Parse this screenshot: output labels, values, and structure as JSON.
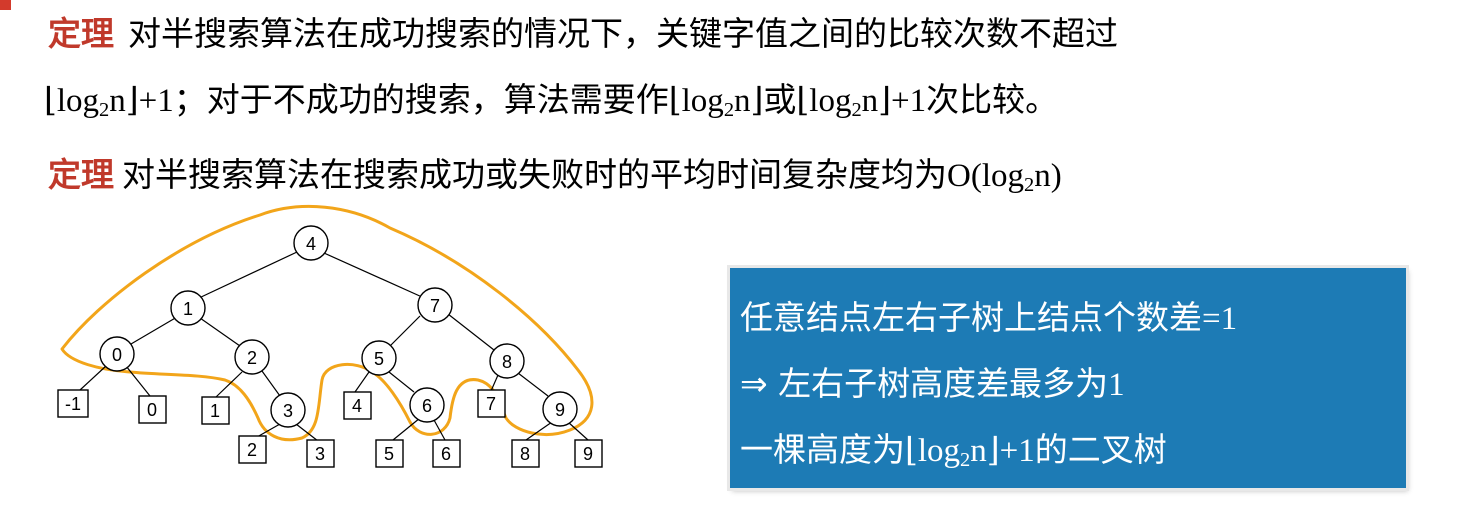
{
  "theorem1": {
    "tag": "定理",
    "text_a": "对半搜索算法在成功搜索的情况下，关键字值之间的比较次数不超过",
    "log": "log",
    "base": "2",
    "var": "n",
    "plus_one": "+1",
    "text_b": "；对于不成功的搜索，算法需要作",
    "text_c": "或",
    "text_d": "次比较。"
  },
  "theorem2": {
    "tag": "定理",
    "text": "对半搜索算法在搜索成功或失败时的平均时间复杂度均为",
    "o_open": "O(log",
    "base": "2",
    "o_close": "n)"
  },
  "tree": {
    "nodes": [
      {
        "id": "n4",
        "label": "4"
      },
      {
        "id": "n1",
        "label": "1"
      },
      {
        "id": "n7",
        "label": "7"
      },
      {
        "id": "n0",
        "label": "0"
      },
      {
        "id": "n2",
        "label": "2"
      },
      {
        "id": "n5",
        "label": "5"
      },
      {
        "id": "n8",
        "label": "8"
      },
      {
        "id": "n3",
        "label": "3"
      },
      {
        "id": "n6",
        "label": "6"
      },
      {
        "id": "n9",
        "label": "9"
      }
    ],
    "leaves": [
      {
        "id": "fm1",
        "label": "-1"
      },
      {
        "id": "f0",
        "label": "0"
      },
      {
        "id": "f1",
        "label": "1"
      },
      {
        "id": "f2",
        "label": "2"
      },
      {
        "id": "f3",
        "label": "3"
      },
      {
        "id": "f4",
        "label": "4"
      },
      {
        "id": "f5",
        "label": "5"
      },
      {
        "id": "f6",
        "label": "6"
      },
      {
        "id": "f7",
        "label": "7"
      },
      {
        "id": "f8",
        "label": "8"
      },
      {
        "id": "f9",
        "label": "9"
      }
    ],
    "highlight_color": "#f2a51a"
  },
  "info_box": {
    "line1": "任意结点左右子树上结点个数差",
    "line1_eq": "=1",
    "line2_arrow": "⇒ ",
    "line2": "左右子树高度差最多为",
    "line2_num": "1",
    "line3": "一棵高度为",
    "line3_log": "log",
    "line3_base": "2",
    "line3_var": "n",
    "line3_plus": "+1",
    "line3_tail": "的二叉树",
    "background": "#1d7bb5"
  },
  "accent_color": "#c0392b"
}
